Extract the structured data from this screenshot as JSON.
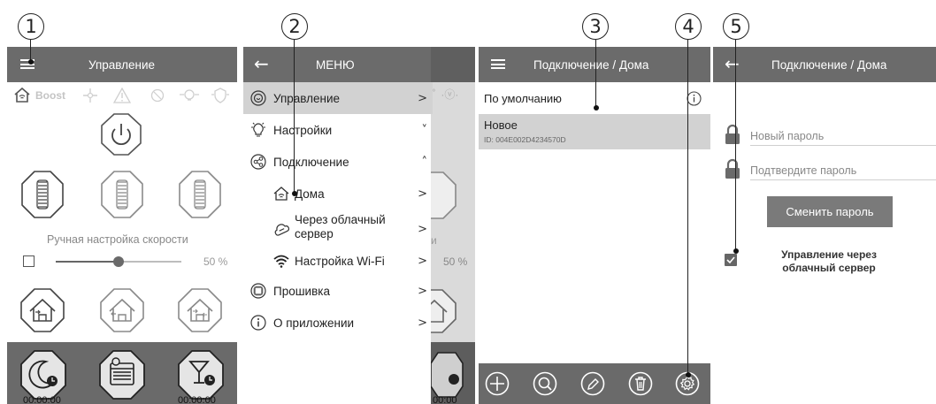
{
  "callouts": [
    "1",
    "2",
    "3",
    "4",
    "5"
  ],
  "panel1": {
    "title": "Управление",
    "mode_label": "Boost",
    "speed_label": "Ручная настройка скорости",
    "speed_value": "50 %",
    "speed_fraction": 0.5,
    "timers": [
      "00:00:00",
      "00:00:00"
    ]
  },
  "panel2": {
    "title": "МЕНЮ",
    "items": [
      {
        "label": "Управление",
        "arrow": ">",
        "icon": "control-icon",
        "active": true
      },
      {
        "label": "Настройки",
        "arrow": "˅",
        "icon": "settings-bulb-icon"
      },
      {
        "label": "Подключение",
        "arrow": "˄",
        "icon": "share-icon"
      },
      {
        "label": "Дома",
        "arrow": ">",
        "icon": "home-wifi-icon",
        "sub": true
      },
      {
        "label": "Через облачный сервер",
        "label_line1": "Через облачный",
        "label_line2": "сервер",
        "arrow": ">",
        "icon": "cloud-icon",
        "sub": true
      },
      {
        "label": "Настройка Wi-Fi",
        "arrow": ">",
        "icon": "wifi-icon",
        "sub": true
      },
      {
        "label": "Прошивка",
        "arrow": ">",
        "icon": "chip-icon"
      },
      {
        "label": "О приложении",
        "arrow": ">",
        "icon": "info-icon"
      }
    ],
    "behind_speed": "50 %",
    "behind_letter": "и",
    "behind_timer": "00:00"
  },
  "panel3": {
    "title": "Подключение / Дома",
    "rows": [
      {
        "name": "По умолчанию",
        "id": ""
      },
      {
        "name": "Новое",
        "id": "ID: 004E002D4234570D"
      }
    ],
    "toolbar_icons": [
      "add-icon",
      "search-icon",
      "edit-icon",
      "delete-icon",
      "settings-icon"
    ]
  },
  "panel4": {
    "title": "Подключение / Дома",
    "new_password_placeholder": "Новый пароль",
    "confirm_password_placeholder": "Подтвердите пароль",
    "change_button": "Сменить пароль",
    "cloud_label_line1": "Управление через",
    "cloud_label_line2": "облачный сервер",
    "cloud_checked": true
  },
  "colors": {
    "topbar": "#6b6b6b",
    "dark_band": "#6a6a6a",
    "selected_row": "#d2d2d2",
    "button": "#7a7a7a"
  }
}
